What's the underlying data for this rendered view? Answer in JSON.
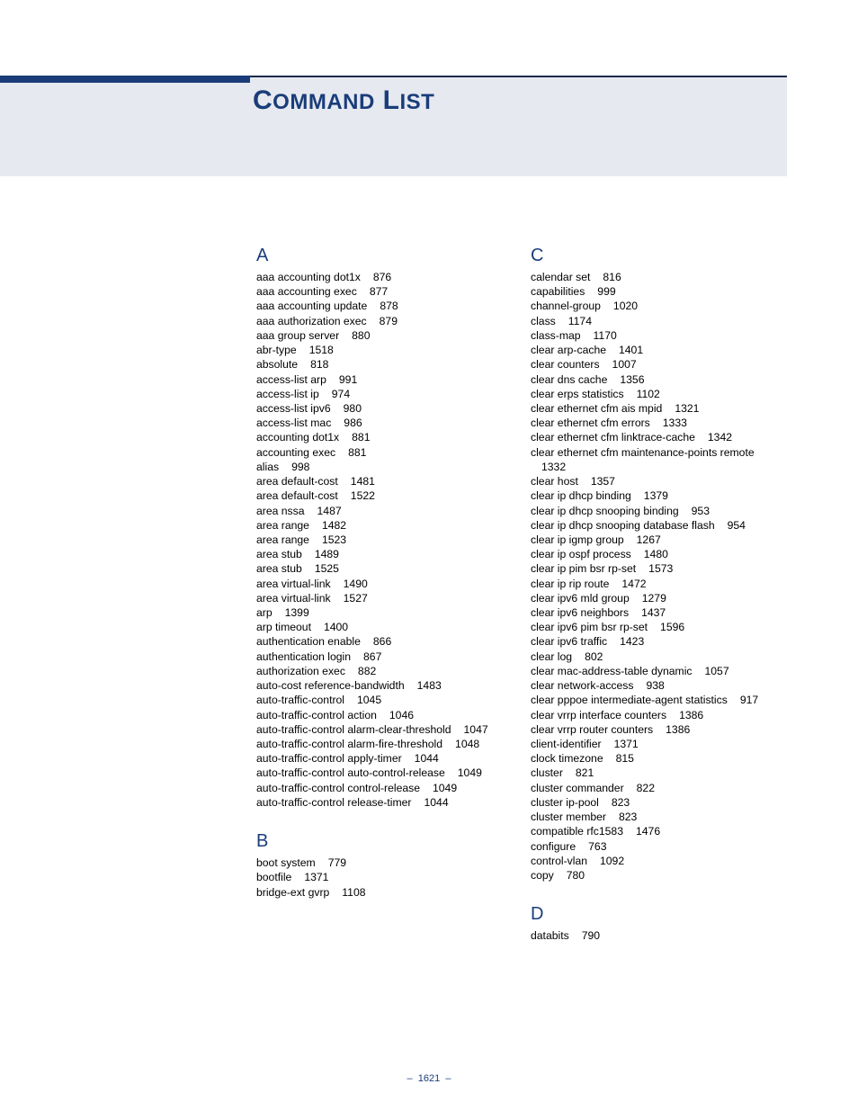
{
  "title": "COMMAND LIST",
  "page_number": "1621",
  "columns": [
    {
      "sections": [
        {
          "letter": "A",
          "entries": [
            {
              "cmd": "aaa accounting dot1x",
              "page": "876"
            },
            {
              "cmd": "aaa accounting exec",
              "page": "877"
            },
            {
              "cmd": "aaa accounting update",
              "page": "878"
            },
            {
              "cmd": "aaa authorization exec",
              "page": "879"
            },
            {
              "cmd": "aaa group server",
              "page": "880"
            },
            {
              "cmd": "abr-type",
              "page": "1518"
            },
            {
              "cmd": "absolute",
              "page": "818"
            },
            {
              "cmd": "access-list arp",
              "page": "991"
            },
            {
              "cmd": "access-list ip",
              "page": "974"
            },
            {
              "cmd": "access-list ipv6",
              "page": "980"
            },
            {
              "cmd": "access-list mac",
              "page": "986"
            },
            {
              "cmd": "accounting dot1x",
              "page": "881"
            },
            {
              "cmd": "accounting exec",
              "page": "881"
            },
            {
              "cmd": "alias",
              "page": "998"
            },
            {
              "cmd": "area default-cost",
              "page": "1481"
            },
            {
              "cmd": "area default-cost",
              "page": "1522"
            },
            {
              "cmd": "area nssa",
              "page": "1487"
            },
            {
              "cmd": "area range",
              "page": "1482"
            },
            {
              "cmd": "area range",
              "page": "1523"
            },
            {
              "cmd": "area stub",
              "page": "1489"
            },
            {
              "cmd": "area stub",
              "page": "1525"
            },
            {
              "cmd": "area virtual-link",
              "page": "1490"
            },
            {
              "cmd": "area virtual-link",
              "page": "1527"
            },
            {
              "cmd": "arp",
              "page": "1399"
            },
            {
              "cmd": "arp timeout",
              "page": "1400"
            },
            {
              "cmd": "authentication enable",
              "page": "866"
            },
            {
              "cmd": "authentication login",
              "page": "867"
            },
            {
              "cmd": "authorization exec",
              "page": "882"
            },
            {
              "cmd": "auto-cost reference-bandwidth",
              "page": "1483"
            },
            {
              "cmd": "auto-traffic-control",
              "page": "1045"
            },
            {
              "cmd": "auto-traffic-control action",
              "page": "1046"
            },
            {
              "cmd": "auto-traffic-control alarm-clear-threshold",
              "page": "1047"
            },
            {
              "cmd": "auto-traffic-control alarm-fire-threshold",
              "page": "1048"
            },
            {
              "cmd": "auto-traffic-control apply-timer",
              "page": "1044"
            },
            {
              "cmd": "auto-traffic-control auto-control-release",
              "page": "1049"
            },
            {
              "cmd": "auto-traffic-control control-release",
              "page": "1049"
            },
            {
              "cmd": "auto-traffic-control release-timer",
              "page": "1044"
            }
          ]
        },
        {
          "letter": "B",
          "entries": [
            {
              "cmd": "boot system",
              "page": "779"
            },
            {
              "cmd": "bootfile",
              "page": "1371"
            },
            {
              "cmd": "bridge-ext gvrp",
              "page": "1108"
            }
          ]
        }
      ]
    },
    {
      "sections": [
        {
          "letter": "C",
          "entries": [
            {
              "cmd": "calendar set",
              "page": "816"
            },
            {
              "cmd": "capabilities",
              "page": "999"
            },
            {
              "cmd": "channel-group",
              "page": "1020"
            },
            {
              "cmd": "class",
              "page": "1174"
            },
            {
              "cmd": "class-map",
              "page": "1170"
            },
            {
              "cmd": "clear arp-cache",
              "page": "1401"
            },
            {
              "cmd": "clear counters",
              "page": "1007"
            },
            {
              "cmd": "clear dns cache",
              "page": "1356"
            },
            {
              "cmd": "clear erps statistics",
              "page": "1102"
            },
            {
              "cmd": "clear ethernet cfm ais mpid",
              "page": "1321"
            },
            {
              "cmd": "clear ethernet cfm errors",
              "page": "1333"
            },
            {
              "cmd": "clear ethernet cfm linktrace-cache",
              "page": "1342"
            },
            {
              "cmd": "clear ethernet cfm maintenance-points remote",
              "page": "1332"
            },
            {
              "cmd": "clear host",
              "page": "1357"
            },
            {
              "cmd": "clear ip dhcp binding",
              "page": "1379"
            },
            {
              "cmd": "clear ip dhcp snooping binding",
              "page": "953"
            },
            {
              "cmd": "clear ip dhcp snooping database flash",
              "page": "954"
            },
            {
              "cmd": "clear ip igmp group",
              "page": "1267"
            },
            {
              "cmd": "clear ip ospf process",
              "page": "1480"
            },
            {
              "cmd": "clear ip pim bsr rp-set",
              "page": "1573"
            },
            {
              "cmd": "clear ip rip route",
              "page": "1472"
            },
            {
              "cmd": "clear ipv6 mld group",
              "page": "1279"
            },
            {
              "cmd": "clear ipv6 neighbors",
              "page": "1437"
            },
            {
              "cmd": "clear ipv6 pim bsr rp-set",
              "page": "1596"
            },
            {
              "cmd": "clear ipv6 traffic",
              "page": "1423"
            },
            {
              "cmd": "clear log",
              "page": "802"
            },
            {
              "cmd": "clear mac-address-table dynamic",
              "page": "1057"
            },
            {
              "cmd": "clear network-access",
              "page": "938"
            },
            {
              "cmd": "clear pppoe intermediate-agent statistics",
              "page": "917"
            },
            {
              "cmd": "clear vrrp interface counters",
              "page": "1386"
            },
            {
              "cmd": "clear vrrp router counters",
              "page": "1386"
            },
            {
              "cmd": "client-identifier",
              "page": "1371"
            },
            {
              "cmd": "clock timezone",
              "page": "815"
            },
            {
              "cmd": "cluster",
              "page": "821"
            },
            {
              "cmd": "cluster commander",
              "page": "822"
            },
            {
              "cmd": "cluster ip-pool",
              "page": "823"
            },
            {
              "cmd": "cluster member",
              "page": "823"
            },
            {
              "cmd": "compatible rfc1583",
              "page": "1476"
            },
            {
              "cmd": "configure",
              "page": "763"
            },
            {
              "cmd": "control-vlan",
              "page": "1092"
            },
            {
              "cmd": "copy",
              "page": "780"
            }
          ]
        },
        {
          "letter": "D",
          "entries": [
            {
              "cmd": "databits",
              "page": "790"
            }
          ]
        }
      ]
    }
  ]
}
